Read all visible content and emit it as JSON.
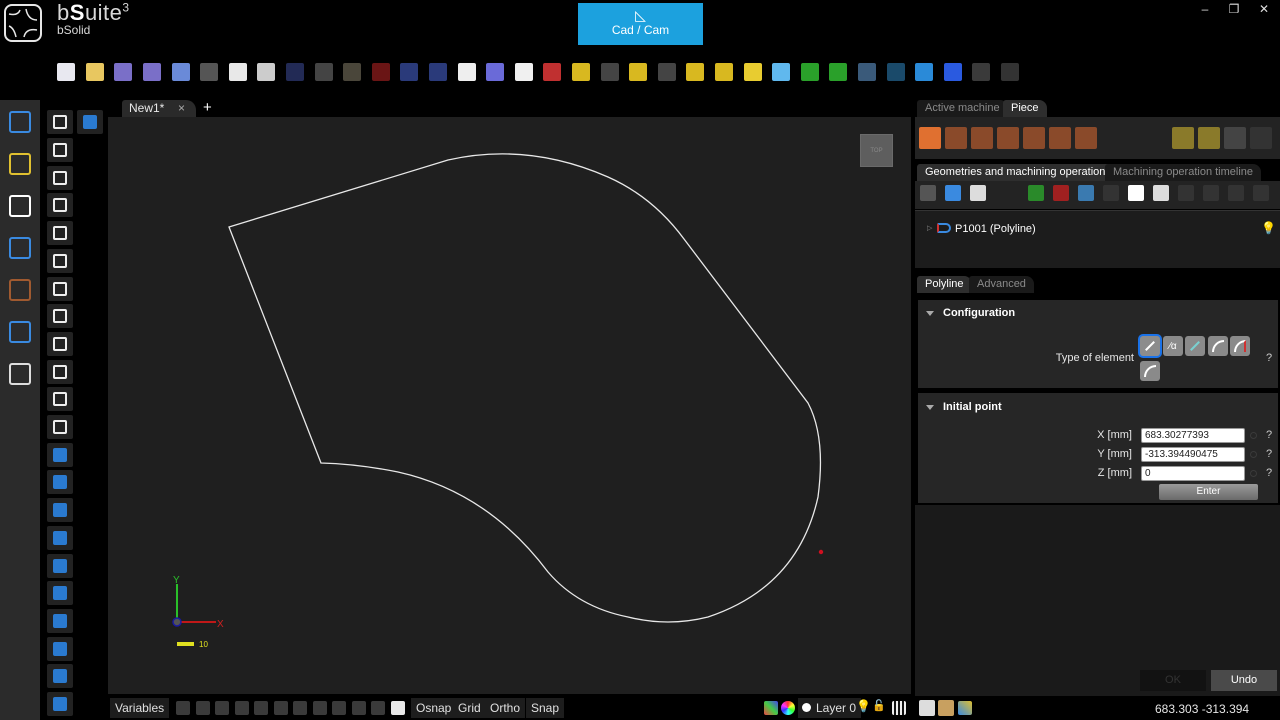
{
  "app": {
    "title_prefix": "b",
    "title_bold": "S",
    "title_rest": "uite",
    "title_sup": "3",
    "subtitle": "bSolid",
    "mode_button": "Cad / Cam",
    "window_controls": {
      "minimize": "–",
      "restore": "❐",
      "close": "✕"
    }
  },
  "toolbar": {
    "icons": [
      {
        "name": "new-file-icon",
        "color": "#e8e8f0"
      },
      {
        "name": "open-folder-icon",
        "color": "#e8c760"
      },
      {
        "name": "save-icon",
        "color": "#7a6fc8"
      },
      {
        "name": "save-as-icon",
        "color": "#7a6fc8"
      },
      {
        "name": "save-all-icon",
        "color": "#6a8ad8"
      },
      {
        "name": "import-icon",
        "color": "#555"
      },
      {
        "name": "export-icon",
        "color": "#e8e8e8"
      },
      {
        "name": "print-icon",
        "color": "#cccccc"
      },
      {
        "name": "cut-icon",
        "color": "#222a55"
      },
      {
        "name": "copy-icon",
        "color": "#444"
      },
      {
        "name": "paste-icon",
        "color": "#4a463a"
      },
      {
        "name": "delete-icon",
        "color": "#6a1515"
      },
      {
        "name": "undo-icon",
        "color": "#2a3a7a"
      },
      {
        "name": "redo-icon",
        "color": "#2a3a7a"
      },
      {
        "name": "crosshair-icon",
        "color": "#eeeeee"
      },
      {
        "name": "orbit-icon",
        "color": "#6a6ad8"
      },
      {
        "name": "pan-hand-icon",
        "color": "#f0f0f0"
      },
      {
        "name": "zoom-extents-icon",
        "color": "#c03030"
      },
      {
        "name": "view-front-icon",
        "color": "#d8b820"
      },
      {
        "name": "view-top-icon",
        "color": "#444"
      },
      {
        "name": "view-left-icon",
        "color": "#d8b820"
      },
      {
        "name": "view-right-icon",
        "color": "#444"
      },
      {
        "name": "view-back-icon",
        "color": "#d8b820"
      },
      {
        "name": "view-iso-icon",
        "color": "#d8b820"
      },
      {
        "name": "view-diamond-icon",
        "color": "#e8cc30"
      },
      {
        "name": "view-3d-icon",
        "color": "#60b8ee"
      },
      {
        "name": "pick-point-icon",
        "color": "#2aa02a"
      },
      {
        "name": "rotate-view-icon",
        "color": "#2aa02a"
      },
      {
        "name": "globe-grid-icon",
        "color": "#3a5a7a"
      },
      {
        "name": "sphere-dark-icon",
        "color": "#1a4a6a"
      },
      {
        "name": "globe-icon",
        "color": "#2a8ad8"
      },
      {
        "name": "help-icon",
        "color": "#2a5ae0"
      },
      {
        "name": "plugin-icon",
        "color": "#3a3a3a"
      },
      {
        "name": "split-view-icon",
        "color": "#333"
      }
    ]
  },
  "document": {
    "tab_label": "New1*",
    "close": "×",
    "add": "+"
  },
  "viewport": {
    "view_cube_label": "TOP",
    "axis_x": "X",
    "axis_y": "Y",
    "scale_label": "10"
  },
  "left_rail": {
    "items": [
      {
        "name": "cad-drafting-icon"
      },
      {
        "name": "transform-icon"
      },
      {
        "name": "measure-icon"
      },
      {
        "name": "protractor-icon"
      },
      {
        "name": "machining-tool-icon"
      },
      {
        "name": "solid-shield-icon"
      },
      {
        "name": "settings-tools-icon"
      }
    ]
  },
  "tools": {
    "items": [
      {
        "name": "point-icon"
      },
      {
        "name": "solid-primitive-icon"
      },
      {
        "name": "line-icon"
      },
      {
        "name": "arc-icon"
      },
      {
        "name": "slot-icon"
      },
      {
        "name": "spline-icon"
      },
      {
        "name": "rectangle-icon"
      },
      {
        "name": "circle-icon"
      },
      {
        "name": "ellipse-icon"
      },
      {
        "name": "polygon-icon"
      },
      {
        "name": "text-icon"
      },
      {
        "name": "text-on-path-icon"
      },
      {
        "name": "region-icon"
      },
      {
        "name": "extrude-icon"
      },
      {
        "name": "revolve-icon"
      },
      {
        "name": "sweep-icon"
      },
      {
        "name": "loft-icon"
      },
      {
        "name": "shell-icon"
      },
      {
        "name": "offset-face-icon"
      },
      {
        "name": "face-select-icon"
      },
      {
        "name": "lasso-icon"
      },
      {
        "name": "surface-grid-icon"
      },
      {
        "name": "image-to-solid-icon"
      }
    ]
  },
  "statusbar": {
    "variables": "Variables",
    "osnap": "Osnap",
    "grid": "Grid",
    "ortho": "Ortho",
    "snap": "Snap",
    "layer": "Layer 0",
    "coordinates": "683.303  -313.394"
  },
  "right_panel": {
    "top_tabs": [
      "Active machine",
      "Piece"
    ],
    "active_top_tab": "Piece",
    "ops_tabs": [
      "Geometries and machining operations",
      "Machining operation timeline"
    ],
    "tree": [
      {
        "label": "P1001 (Polyline)"
      }
    ],
    "prop_tabs": [
      "Polyline",
      "Advanced"
    ],
    "configuration": {
      "title": "Configuration",
      "type_label": "Type of element",
      "help": "?"
    },
    "initial_point": {
      "title": "Initial point",
      "fields": [
        {
          "label": "X [mm]",
          "value": "683.30277393"
        },
        {
          "label": "Y [mm]",
          "value": "-313.394490475"
        },
        {
          "label": "Z [mm]",
          "value": "0"
        }
      ],
      "help": "?",
      "enter": "Enter"
    },
    "ok": "OK",
    "undo": "Undo"
  }
}
